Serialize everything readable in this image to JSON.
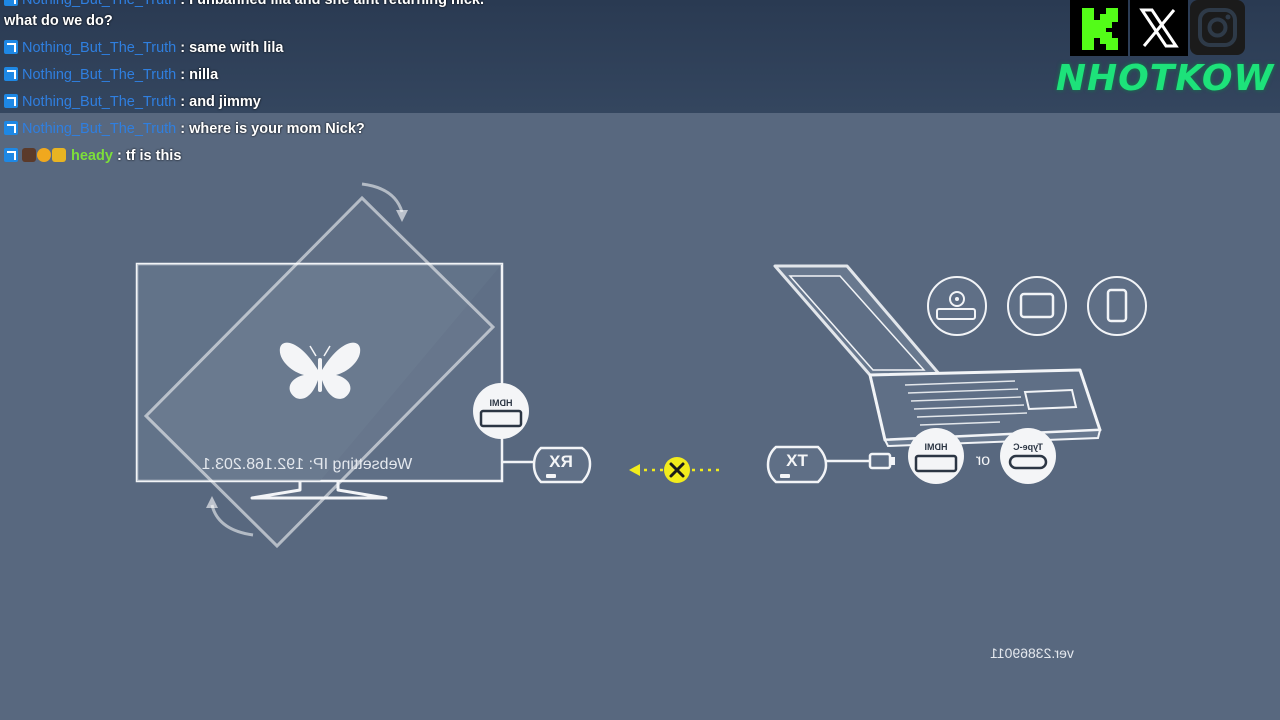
{
  "chat": {
    "messages": [
      {
        "user": "Nothing_But_The_Truth",
        "sep": " : ",
        "text": "I unbanned lila and she aint returning nick.",
        "continuation": "what do we do?"
      },
      {
        "user": "Nothing_But_The_Truth",
        "sep": " : ",
        "text": "same with lila"
      },
      {
        "user": "Nothing_But_The_Truth",
        "sep": " : ",
        "text": "nilla"
      },
      {
        "user": "Nothing_But_The_Truth",
        "sep": " : ",
        "text": "and jimmy"
      },
      {
        "user": "Nothing_But_The_Truth",
        "sep": " : ",
        "text": "where is your mom Nick?"
      },
      {
        "user": "heady",
        "sep": " : ",
        "text": "tf is this"
      }
    ]
  },
  "branding": {
    "name": "NHOTKOW",
    "icons": [
      "kick-icon",
      "x-icon",
      "instagram-icon"
    ],
    "accent_color": "#1de27a"
  },
  "scene": {
    "websetting_ip": "Websetting IP: 192.168.203.1",
    "rx_label": "RX",
    "tx_label": "TX",
    "hdmi_label": "HDMI",
    "or_label": "or",
    "typec_label": "Type-C",
    "version": "ver.23869011",
    "connection_status_color": "#f2ec1c",
    "background_color": "#58687f"
  }
}
